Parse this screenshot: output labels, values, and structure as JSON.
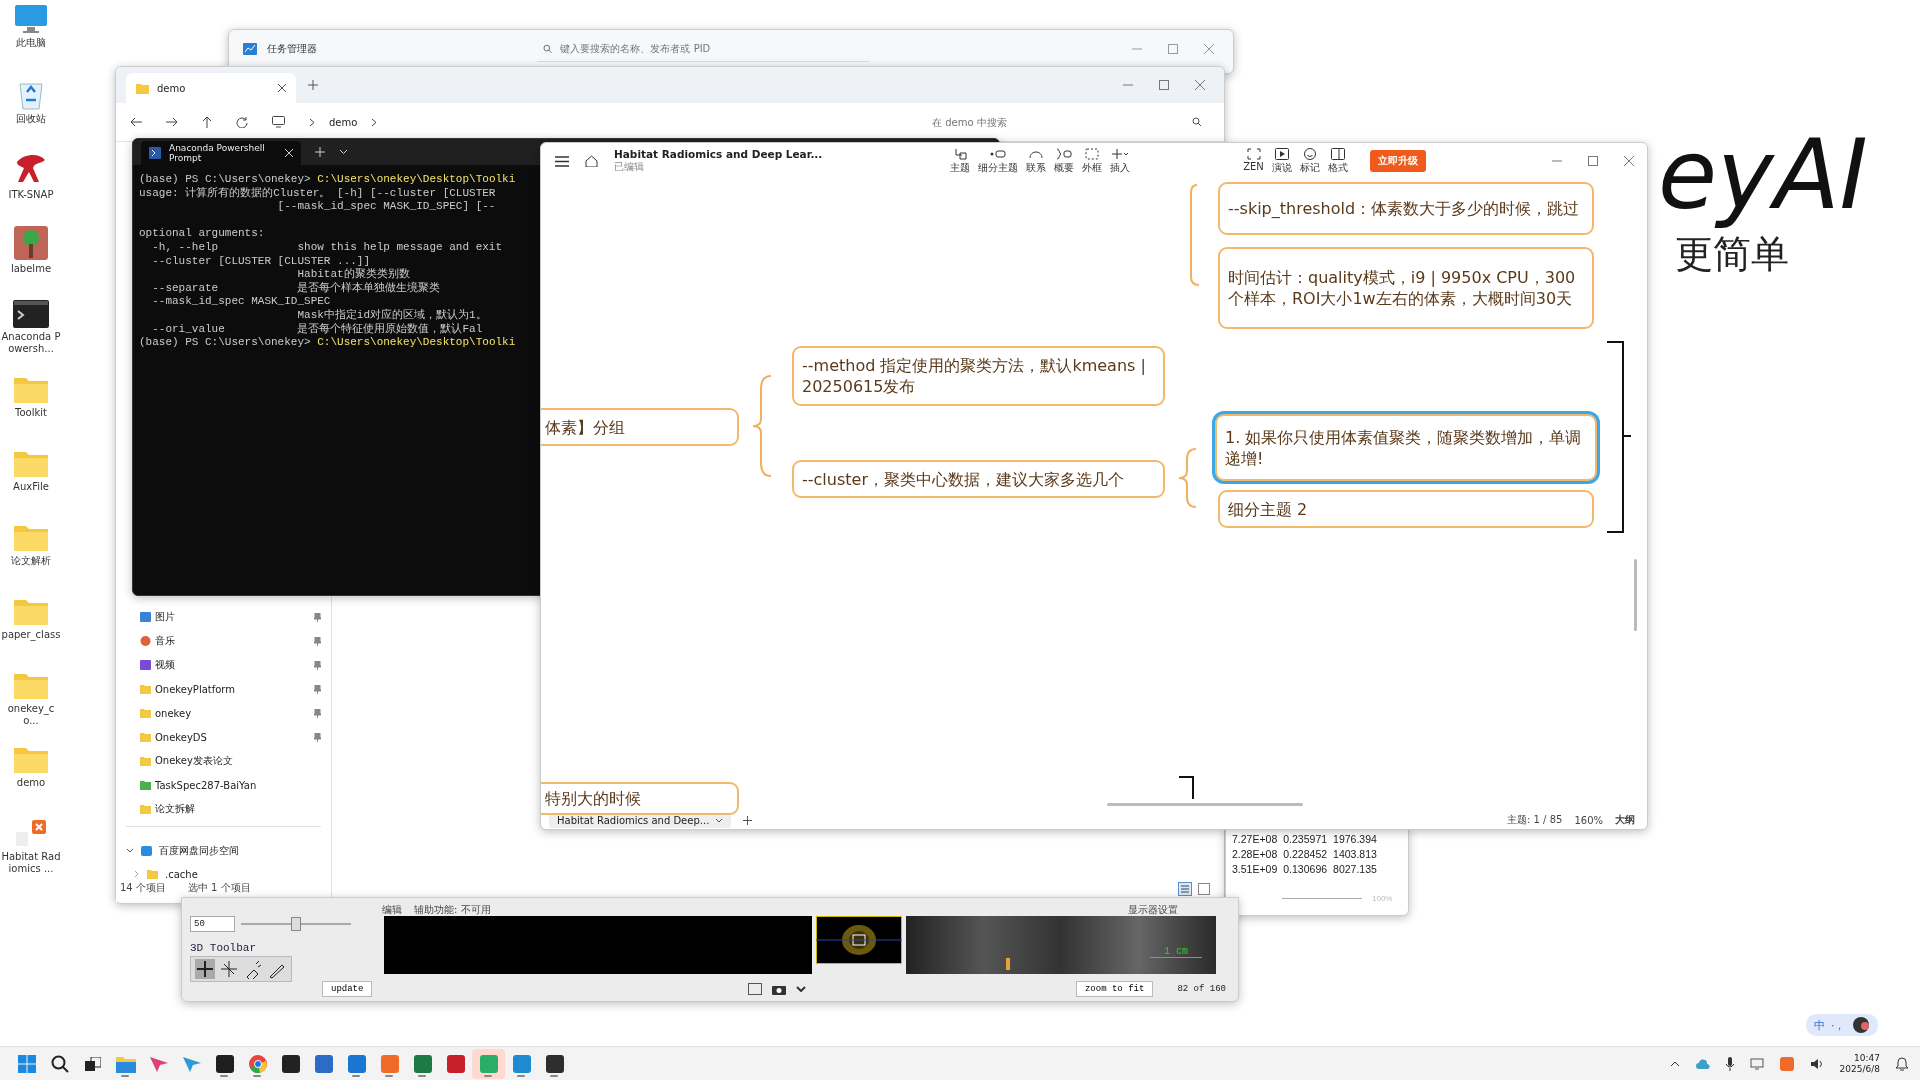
{
  "desktop_icons": [
    {
      "label": "此电脑",
      "kind": "computer"
    },
    {
      "label": "回收站",
      "kind": "recycle"
    },
    {
      "label": "ITK-SNAP",
      "kind": "itk"
    },
    {
      "label": "labelme",
      "kind": "labelme"
    },
    {
      "label": "Anaconda Powersh...",
      "kind": "terminal"
    },
    {
      "label": "Toolkit",
      "kind": "folder"
    },
    {
      "label": "AuxFile",
      "kind": "folder"
    },
    {
      "label": "论文解析",
      "kind": "folder"
    },
    {
      "label": "paper_class",
      "kind": "folder"
    },
    {
      "label": "onekey_co...",
      "kind": "folder"
    },
    {
      "label": "demo",
      "kind": "folder"
    },
    {
      "label": "Habitat Radiomics ...",
      "kind": "habitat"
    }
  ],
  "logo": {
    "wordmark": "eyAI",
    "slogan": "更简单"
  },
  "task_manager": {
    "title": "任务管理器",
    "search": {
      "placeholder": "键入要搜索的名称、发布者或 PID"
    }
  },
  "explorer": {
    "tab": "demo",
    "breadcrumb": "demo",
    "search": {
      "placeholder": "在 demo 中搜索"
    },
    "sidebar": [
      {
        "label": "图片",
        "kind": "pictures",
        "pinned": true
      },
      {
        "label": "音乐",
        "kind": "music",
        "pinned": true
      },
      {
        "label": "视频",
        "kind": "video",
        "pinned": true
      },
      {
        "label": "OnekeyPlatform",
        "kind": "folder",
        "pinned": true
      },
      {
        "label": "onekey",
        "kind": "folder",
        "pinned": true
      },
      {
        "label": "OnekeyDS",
        "kind": "folder",
        "pinned": true
      },
      {
        "label": "Onekey发表论文",
        "kind": "folder",
        "pinned": false
      },
      {
        "label": "TaskSpec287-BaiYan",
        "kind": "shared",
        "pinned": false
      },
      {
        "label": "论文拆解",
        "kind": "folder",
        "pinned": false
      }
    ],
    "cloud_drive": "百度网盘同步空间",
    "subfolder": ".cache",
    "status": [
      "14 个项目",
      "选中 1 个项目"
    ]
  },
  "terminal": {
    "title": "Anaconda Powershell Prompt",
    "lines": [
      {
        "kind": "prompt",
        "prompt": "(base) PS C:\\Users\\onekey>",
        "command": "C:\\Users\\onekey\\Desktop\\Toolki"
      },
      {
        "kind": "text",
        "text": "usage: 计算所有的数据的Cluster。 [-h] [--cluster [CLUSTER"
      },
      {
        "kind": "text",
        "text": "                     [--mask_id_spec MASK_ID_SPEC] [--"
      },
      {
        "kind": "heading",
        "text": "optional arguments:"
      },
      {
        "kind": "text",
        "text": "  -h, --help            show this help message and exit"
      },
      {
        "kind": "text",
        "text": "  --cluster [CLUSTER [CLUSTER ...]]"
      },
      {
        "kind": "text",
        "text": "                        Habitat的聚类类别数"
      },
      {
        "kind": "text",
        "text": "  --separate            是否每个样本单独做生境聚类"
      },
      {
        "kind": "text",
        "text": "  --mask_id_spec MASK_ID_SPEC"
      },
      {
        "kind": "text",
        "text": "                        Mask中指定id对应的区域，默认为1。"
      },
      {
        "kind": "text",
        "text": "  --ori_value           是否每个特征使用原始数值，默认Fal"
      },
      {
        "kind": "prompt",
        "prompt": "(base) PS C:\\Users\\onekey>",
        "command": "C:\\Users\\onekey\\Desktop\\Toolki"
      }
    ]
  },
  "mindmap": {
    "title": "Habitat Radiomics and Deep Lear...",
    "subtitle": "已编辑",
    "tools": [
      {
        "label": "主题",
        "kind": "topic"
      },
      {
        "label": "细分主题",
        "kind": "subtopic"
      },
      {
        "label": "联系",
        "kind": "relation"
      },
      {
        "label": "概要",
        "kind": "summary"
      },
      {
        "label": "外框",
        "kind": "boundary"
      },
      {
        "label": "插入",
        "kind": "insert"
      }
    ],
    "view_tools": [
      {
        "label": "ZEN",
        "kind": "zen"
      },
      {
        "label": "演说",
        "kind": "pitch"
      },
      {
        "label": "标记",
        "kind": "marker"
      },
      {
        "label": "格式",
        "kind": "format"
      }
    ],
    "upgrade": "立即升级",
    "nodes": [
      {
        "text": "--skip_threshold：体素数大于多少的时候，跳过",
        "selected": false
      },
      {
        "text": "时间估计：quality模式，i9 | 9950x CPU，300个样本，ROI大小1w左右的体素，大概时间30天",
        "selected": false
      },
      {
        "text": "--method 指定使用的聚类方法，默认kmeans | 20250615发布",
        "selected": false
      },
      {
        "text": "体素】分组",
        "selected": false
      },
      {
        "text": "--cluster，聚类中心数据，建议大家多选几个",
        "selected": false
      },
      {
        "text": "1. 如果你只使用体素值聚类，随聚类数增加，单调递增!",
        "selected": true
      },
      {
        "text": "细分主题 2",
        "selected": false
      },
      {
        "text": "特别大的时候",
        "selected": false
      }
    ],
    "tab": "Habitat Radiomics and Deep...",
    "status": "主题: 1 / 85",
    "zoom": "160%",
    "outline": "大纲"
  },
  "table": {
    "rows": [
      [
        "7.27E+08",
        "0.235971",
        "1976.394"
      ],
      [
        "2.28E+08",
        "0.228452",
        "1403.813"
      ],
      [
        "3.51E+09",
        "0.130696",
        "8027.135"
      ]
    ],
    "zoom": "100%"
  },
  "itk": {
    "menu": [
      "编辑",
      "辅助功能: 不可用"
    ],
    "display_settings": "显示器设置",
    "value": "50",
    "slider": {
      "level": 0.5
    },
    "toolbar_title": "3D Toolbar",
    "update": "update",
    "scale": "1 cm",
    "zoom_fit": "zoom to fit",
    "slice": "82 of 160"
  },
  "ime": {
    "mode": "中",
    "punct": "·，"
  },
  "taskbar": {
    "apps": [
      {
        "kind": "start",
        "running": false
      },
      {
        "kind": "search",
        "running": false
      },
      {
        "kind": "taskview",
        "running": false
      },
      {
        "kind": "explorer",
        "running": true
      },
      {
        "kind": "pinkarrow",
        "running": false
      },
      {
        "kind": "bluearrow",
        "running": false
      },
      {
        "kind": "pycharm",
        "running": true
      },
      {
        "kind": "chrome",
        "running": true
      },
      {
        "kind": "obs",
        "running": false
      },
      {
        "kind": "figure",
        "running": false
      },
      {
        "kind": "mountain",
        "running": true
      },
      {
        "kind": "orange",
        "running": true
      },
      {
        "kind": "excel",
        "running": true
      },
      {
        "kind": "itk",
        "running": false
      },
      {
        "kind": "wechat",
        "running": true,
        "selected": true
      },
      {
        "kind": "window",
        "running": true
      },
      {
        "kind": "terminal",
        "running": true
      }
    ],
    "time": "10:47",
    "date": "2025/6/8"
  }
}
